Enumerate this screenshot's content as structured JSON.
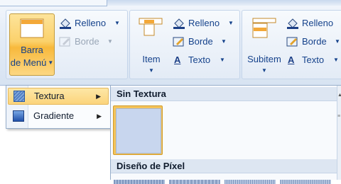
{
  "ribbon": {
    "group1": {
      "bar_button": {
        "line1": "Barra",
        "line2": "de Menú"
      },
      "fill_label": "Relleno",
      "border_label": "Borde"
    },
    "group2": {
      "item_button": "Item",
      "fill_label": "Relleno",
      "border_label": "Borde",
      "text_label": "Texto"
    },
    "group3": {
      "subitem_button": "Subitem",
      "fill_label": "Relleno",
      "border_label": "Borde",
      "text_label": "Texto"
    }
  },
  "dropdown_menu": {
    "items": [
      {
        "label": "Textura",
        "icon": "texture-icon",
        "highlighted": true
      },
      {
        "label": "Gradiente",
        "icon": "gradient-icon",
        "highlighted": false
      }
    ]
  },
  "gallery": {
    "section1_title": "Sin Textura",
    "section2_title": "Diseño de Píxel"
  },
  "colors": {
    "accent_active": "#fbd16b",
    "ribbon_text": "#15428b",
    "ribbon_bg": "#dfe8f5"
  }
}
